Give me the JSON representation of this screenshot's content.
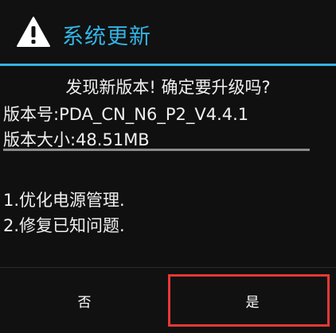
{
  "dialog": {
    "title": "系统更新",
    "icon": "warning-icon",
    "accent_color": "#33b5e5",
    "question": "发现新版本! 确定要升级吗?",
    "version_line": "版本号:PDA_CN_N6_P2_V4.4.1",
    "size_line": "版本大小:48.51MB",
    "notes": [
      "1.优化电源管理.",
      "2.修复已知问题."
    ],
    "buttons": {
      "cancel_label": "否",
      "confirm_label": "是"
    },
    "highlight_color": "#e53935"
  }
}
